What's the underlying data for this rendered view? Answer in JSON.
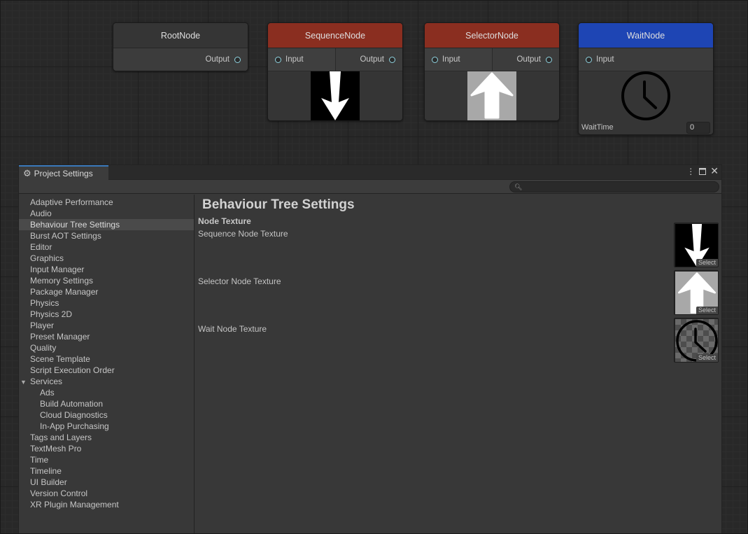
{
  "graph": {
    "nodes": [
      {
        "title": "RootNode",
        "output": "Output",
        "title_color": "#353535"
      },
      {
        "title": "SequenceNode",
        "input": "Input",
        "output": "Output",
        "title_color": "#8a2e20"
      },
      {
        "title": "SelectorNode",
        "input": "Input",
        "output": "Output",
        "title_color": "#8a2e20"
      },
      {
        "title": "WaitNode",
        "input": "Input",
        "field_label": "WaitTime",
        "field_value": "0",
        "title_color": "#1e45b4"
      }
    ]
  },
  "window": {
    "tab_title": "Project Settings",
    "search": {
      "placeholder": ""
    },
    "sidebar": {
      "items": [
        "Adaptive Performance",
        "Audio",
        "Behaviour Tree Settings",
        "Burst AOT Settings",
        "Editor",
        "Graphics",
        "Input Manager",
        "Memory Settings",
        "Package Manager",
        "Physics",
        "Physics 2D",
        "Player",
        "Preset Manager",
        "Quality",
        "Scene Template",
        "Script Execution Order",
        "Services",
        "Ads",
        "Build Automation",
        "Cloud Diagnostics",
        "In-App Purchasing",
        "Tags and Layers",
        "TextMesh Pro",
        "Time",
        "Timeline",
        "UI Builder",
        "Version Control",
        "XR Plugin Management"
      ],
      "selected": "Behaviour Tree Settings"
    },
    "content": {
      "title": "Behaviour Tree Settings",
      "section": "Node Texture",
      "fields": [
        {
          "label": "Sequence Node Texture",
          "select": "Select"
        },
        {
          "label": "Selector Node Texture",
          "select": "Select"
        },
        {
          "label": "Wait Node Texture",
          "select": "Select"
        }
      ]
    }
  },
  "icons": {
    "tab": "gear-icon",
    "window_controls": [
      "more-icon",
      "maximize-icon",
      "close-icon"
    ],
    "search": "search-icon"
  },
  "colors": {
    "accent": "#3a79bb",
    "port": "#8fd3e0"
  }
}
